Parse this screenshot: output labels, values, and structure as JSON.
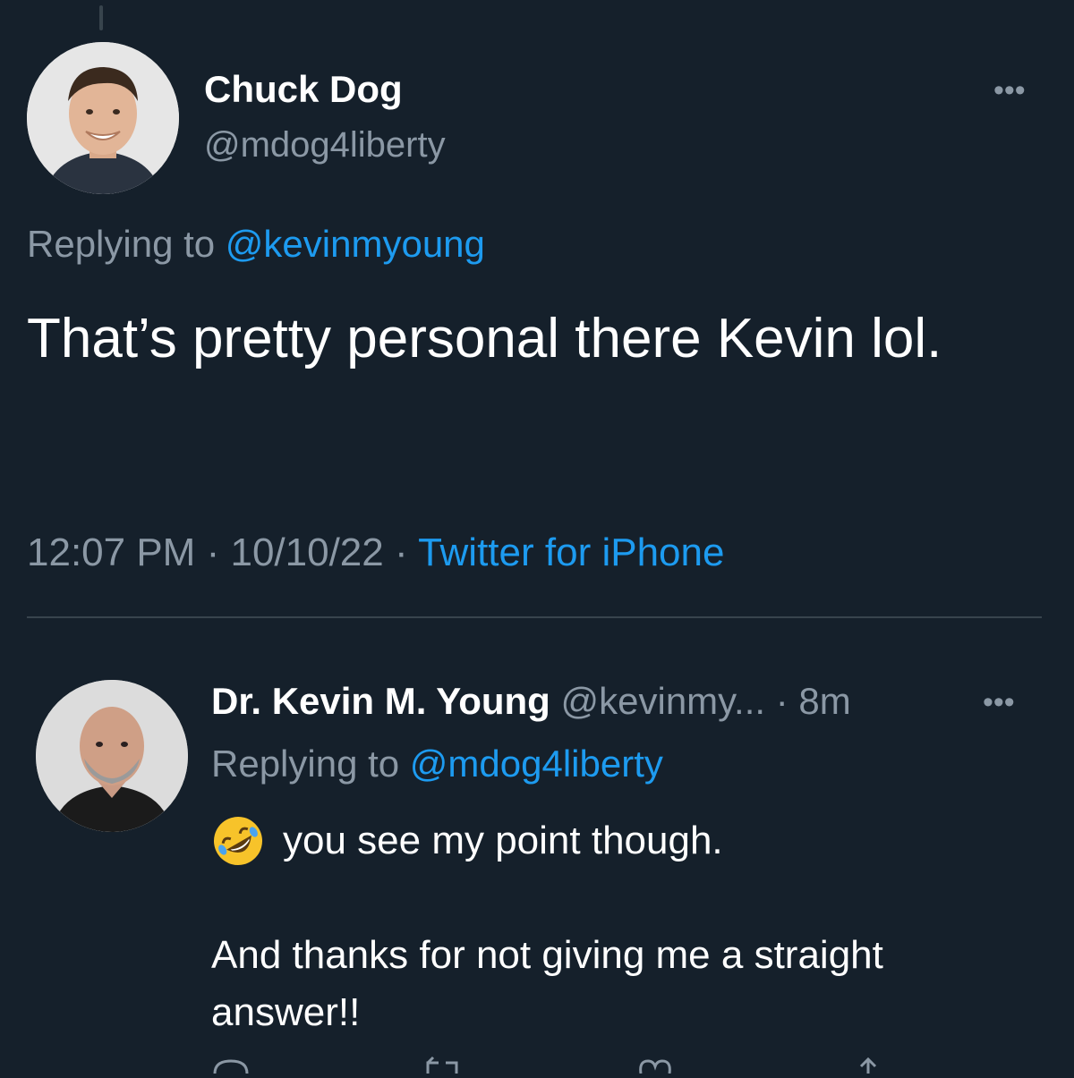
{
  "main_tweet": {
    "display_name": "Chuck Dog",
    "handle": "@mdog4liberty",
    "replying_prefix": "Replying to",
    "replying_handle": "@kevinmyoung",
    "text": "That’s pretty personal there Kevin lol.",
    "time": "12:07 PM",
    "date": "10/10/22",
    "source": "Twitter for iPhone",
    "separator": "·"
  },
  "reply_tweet": {
    "display_name": "Dr. Kevin M. Young",
    "handle": "@kevinmy...",
    "age": "8m",
    "separator": "·",
    "replying_prefix": "Replying to",
    "replying_handle": "@mdog4liberty",
    "line1": "you see my point though.",
    "line2": "And thanks for not giving me a straight answer!!"
  },
  "colors": {
    "background": "#15202b",
    "text": "#ffffff",
    "muted": "#8b98a5",
    "accent": "#1d9bf0",
    "divider": "#38444d"
  },
  "icons": [
    "more-icon",
    "rolling-on-floor-laughing-emoji",
    "reply-icon",
    "retweet-icon",
    "like-icon",
    "share-icon"
  ]
}
